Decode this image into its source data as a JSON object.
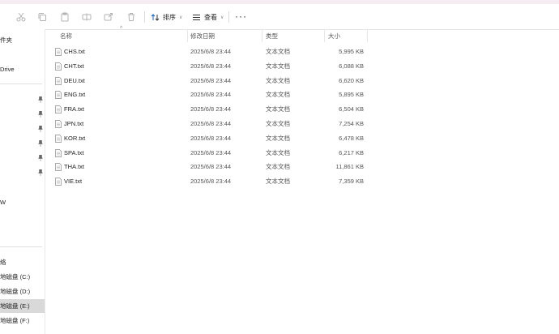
{
  "toolbar": {
    "sort_label": "排序",
    "view_label": "查看",
    "more_label": "···"
  },
  "nav": {
    "items": [
      {
        "label": "件夹"
      },
      {
        "label": "Drive"
      },
      {
        "label": "W"
      },
      {
        "label": "络"
      },
      {
        "label": "地磁盘 (C:)"
      },
      {
        "label": "地磁盘 (D:)"
      },
      {
        "label": "地磁盘 (E:)"
      },
      {
        "label": "地磁盘 (F:)"
      }
    ]
  },
  "columns": {
    "name": "名称",
    "modified": "修改日期",
    "type": "类型",
    "size": "大小"
  },
  "files": [
    {
      "name": "CHS.txt",
      "modified": "2025/6/8 23:44",
      "type": "文本文档",
      "size": "5,995 KB"
    },
    {
      "name": "CHT.txt",
      "modified": "2025/6/8 23:44",
      "type": "文本文档",
      "size": "6,088 KB"
    },
    {
      "name": "DEU.txt",
      "modified": "2025/6/8 23:44",
      "type": "文本文档",
      "size": "6,620 KB"
    },
    {
      "name": "ENG.txt",
      "modified": "2025/6/8 23:44",
      "type": "文本文档",
      "size": "5,895 KB"
    },
    {
      "name": "FRA.txt",
      "modified": "2025/6/8 23:44",
      "type": "文本文档",
      "size": "6,504 KB"
    },
    {
      "name": "JPN.txt",
      "modified": "2025/6/8 23:44",
      "type": "文本文档",
      "size": "7,254 KB"
    },
    {
      "name": "KOR.txt",
      "modified": "2025/6/8 23:44",
      "type": "文本文档",
      "size": "6,478 KB"
    },
    {
      "name": "SPA.txt",
      "modified": "2025/6/8 23:44",
      "type": "文本文档",
      "size": "6,217 KB"
    },
    {
      "name": "THA.txt",
      "modified": "2025/6/8 23:44",
      "type": "文本文档",
      "size": "11,861 KB"
    },
    {
      "name": "VIE.txt",
      "modified": "2025/6/8 23:44",
      "type": "文本文档",
      "size": "7,359 KB"
    }
  ]
}
